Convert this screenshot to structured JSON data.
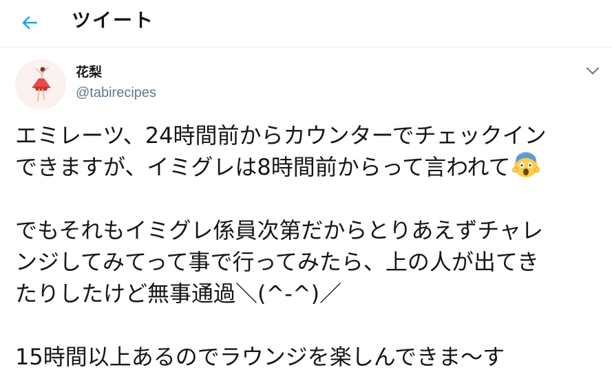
{
  "header": {
    "title": "ツイート",
    "back_icon": "arrow-left-icon"
  },
  "author": {
    "display_name": "花梨",
    "handle": "@tabirecipes",
    "avatar_icon": "ballerina-avatar"
  },
  "menu_icon": "chevron-down-icon",
  "accent_color": "#1da1f2",
  "tweet": {
    "lines": [
      "エミレーツ、24時間前からカウンターでチェックイン",
      "できますが、イミグレは8時間前からって言われて",
      "でもそれもイミグレ係員次第だからとりあえずチャレ",
      "ンジしてみてって事で行ってみたら、上の人が出てき",
      "たりしたけど無事通過＼(^-^)／",
      "15時間以上あるのでラウンジを楽しんできま〜す"
    ],
    "emoji_icon": "face-screaming-in-fear-icon"
  }
}
